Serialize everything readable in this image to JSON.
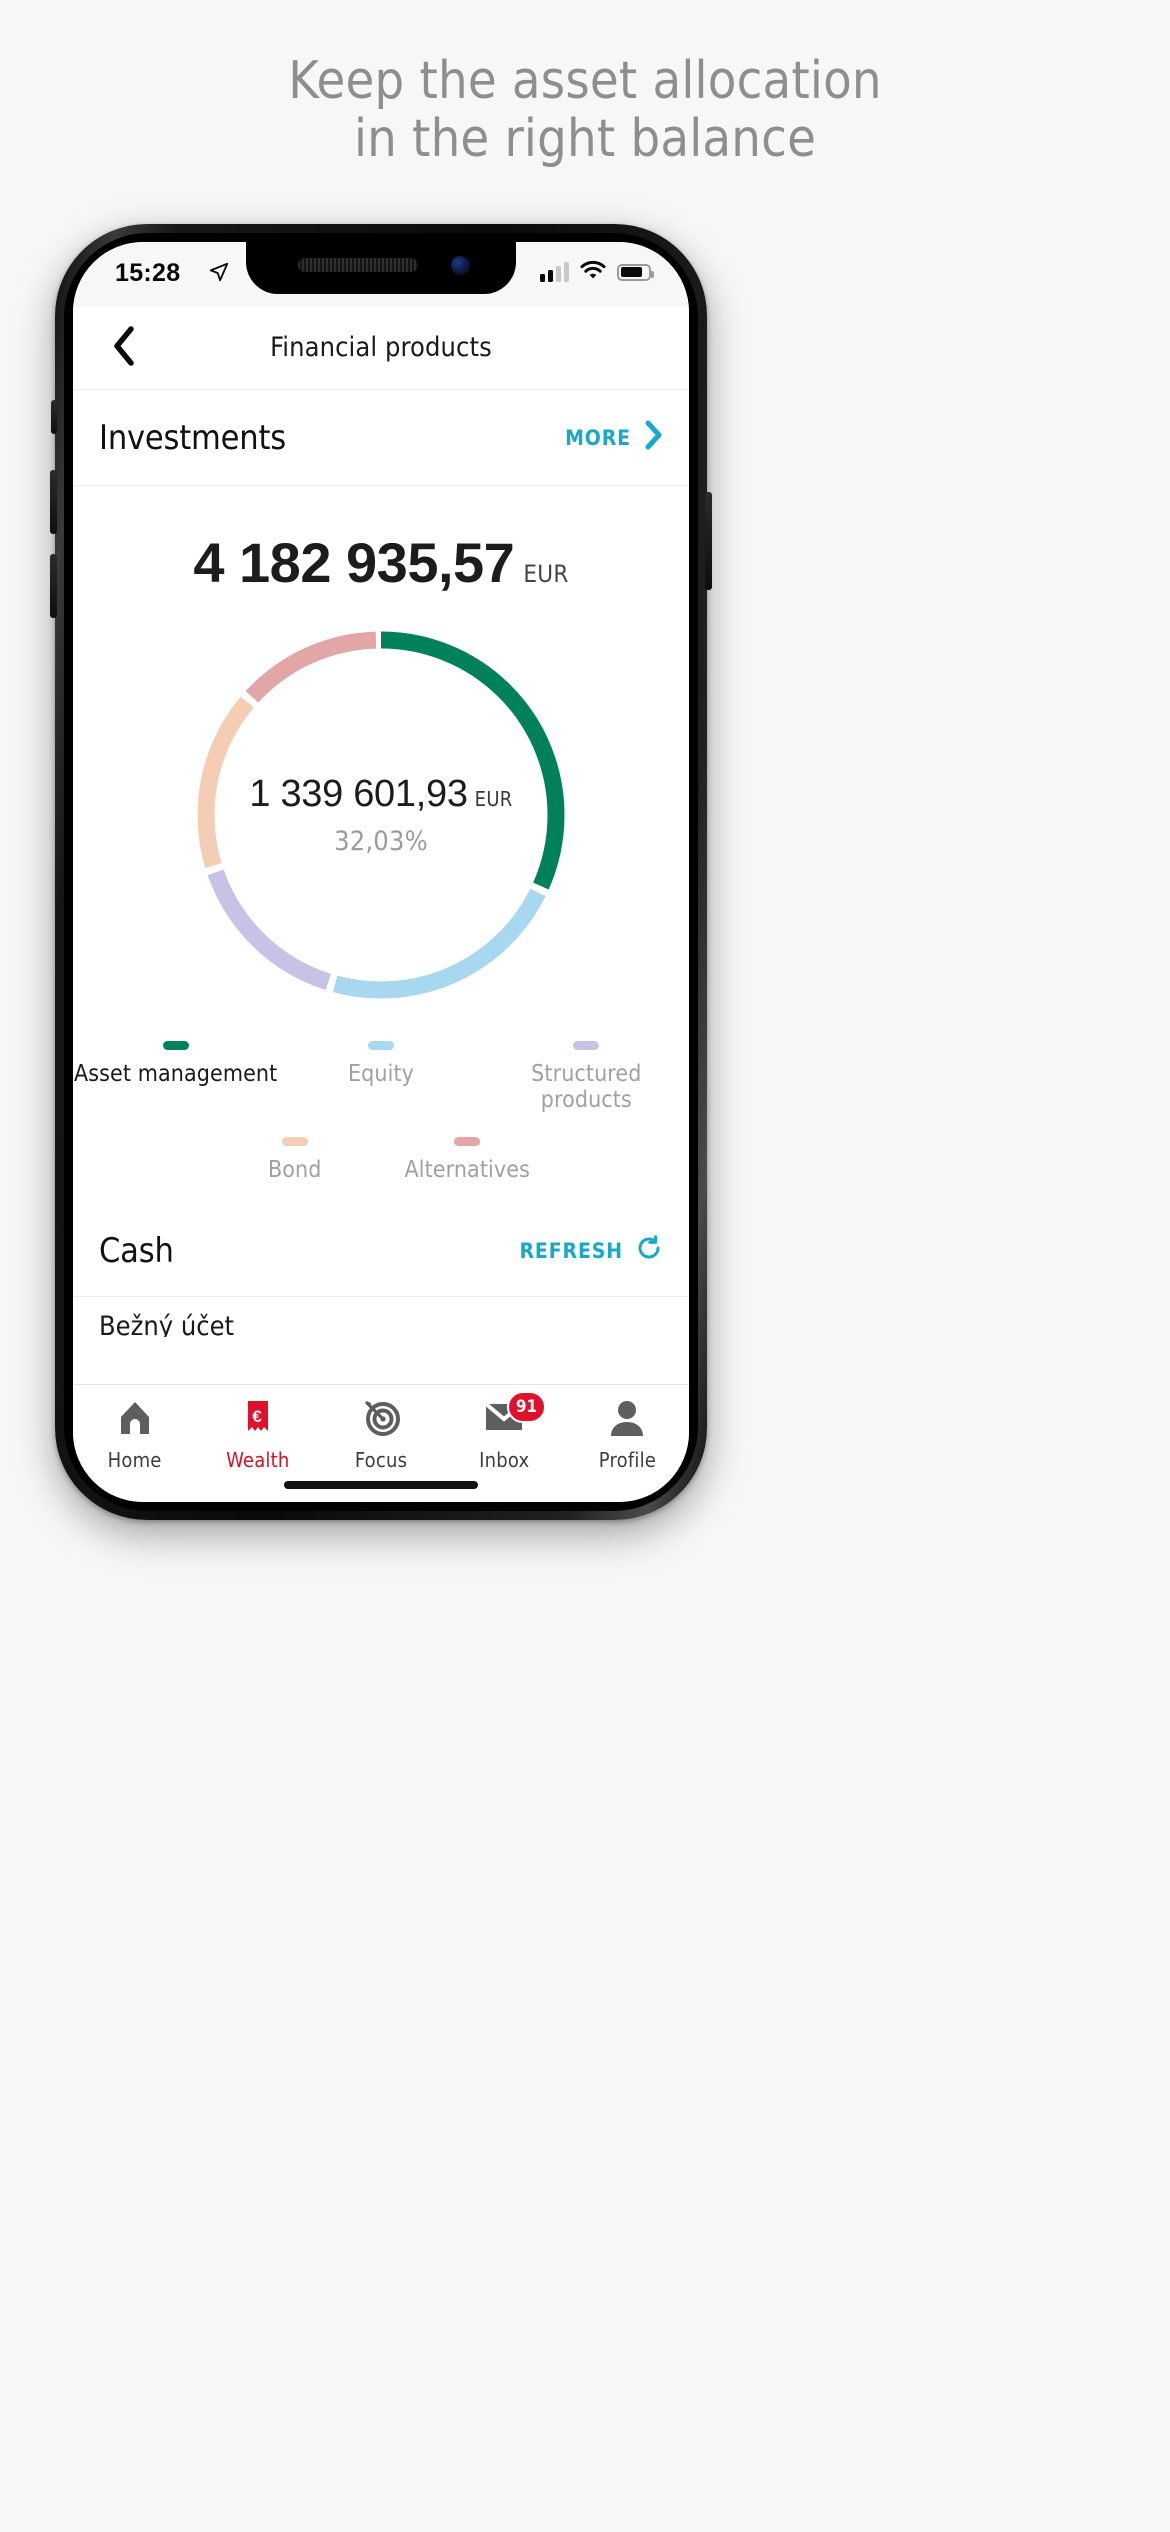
{
  "promo": {
    "line1": "Keep the asset allocation",
    "line2": "in the right balance",
    "color": "#8e8e8e"
  },
  "statusbar": {
    "time": "15:28",
    "location_icon": "location-arrow-icon",
    "signal_icon": "cellular-signal-icon",
    "signal_bars_filled": 2,
    "signal_bars_total": 4,
    "wifi_icon": "wifi-icon",
    "battery_icon": "battery-icon",
    "battery_level_pct": 62
  },
  "navbar": {
    "back_icon": "chevron-left-icon",
    "title": "Financial products"
  },
  "investments": {
    "title": "Investments",
    "more_label": "MORE",
    "more_icon": "chevron-right-icon",
    "total_amount": "4 182 935,57",
    "total_currency": "EUR",
    "selected_amount": "1 339 601,93",
    "selected_currency": "EUR",
    "selected_percent": "32,03%"
  },
  "chart_data": {
    "type": "pie",
    "title": "Investments allocation",
    "total": "4 182 935,57",
    "currency": "EUR",
    "selected": "Asset management",
    "selected_value": "1 339 601,93",
    "selected_percent": 32.03,
    "categories": [
      "Asset management",
      "Equity",
      "Structured products",
      "Bond",
      "Alternatives"
    ],
    "values": [
      32.03,
      22.5,
      15.5,
      16.5,
      13.47
    ],
    "colors": [
      "#00815a",
      "#a7d8ef",
      "#c8c3e6",
      "#f5cdb4",
      "#e2a6a6"
    ],
    "legend_position": "below",
    "donut": true
  },
  "legend": {
    "row1": [
      {
        "label": "Asset management",
        "color": "#00815a",
        "active": true
      },
      {
        "label": "Equity",
        "color": "#a7d8ef",
        "active": false
      },
      {
        "label": "Structured products",
        "color": "#c8c3e6",
        "active": false
      }
    ],
    "row2": [
      {
        "label": "Bond",
        "color": "#f5cdb4",
        "active": false
      },
      {
        "label": "Alternatives",
        "color": "#e2a6a6",
        "active": false
      }
    ]
  },
  "cash": {
    "title": "Cash",
    "refresh_label": "REFRESH",
    "refresh_icon": "refresh-icon",
    "first_account": "Bežný účet"
  },
  "tabbar": {
    "items": [
      {
        "label": "Home",
        "icon": "home-icon",
        "active": false,
        "badge": ""
      },
      {
        "label": "Wealth",
        "icon": "euro-wealth-icon",
        "active": true,
        "badge": ""
      },
      {
        "label": "Focus",
        "icon": "target-icon",
        "active": false,
        "badge": ""
      },
      {
        "label": "Inbox",
        "icon": "envelope-icon",
        "active": false,
        "badge": "91"
      },
      {
        "label": "Profile",
        "icon": "person-icon",
        "active": false,
        "badge": ""
      }
    ]
  },
  "colors": {
    "accent_cyan": "#17a8cc",
    "brand_red": "#d6122b",
    "badge_red": "#e0112b"
  }
}
